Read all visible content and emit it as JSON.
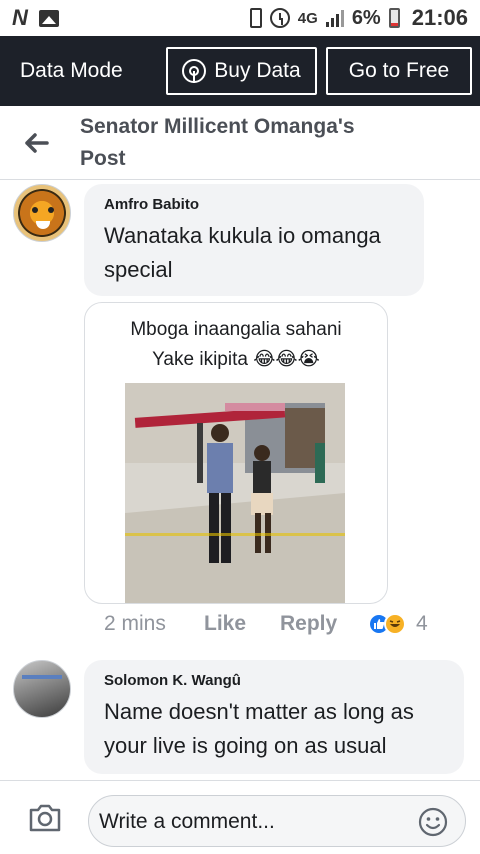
{
  "status_bar": {
    "network": "4G",
    "battery_percent": "6%",
    "time": "21:06",
    "icons": [
      "n-icon",
      "image-icon",
      "phone-icon",
      "alarm-icon",
      "signal-icon",
      "battery-icon"
    ]
  },
  "data_mode": {
    "label": "Data Mode",
    "buy_label": "Buy Data",
    "free_label": "Go to Free"
  },
  "header": {
    "title": "Senator Millicent Omanga's Post"
  },
  "comments": [
    {
      "author": "Amfro Babito",
      "text": "Wanataka kukula io omanga special",
      "meme_caption_line1": "Mboga inaangalia sahani",
      "meme_caption_line2": "Yake ikipita 😂😂😭",
      "time": "2 mins",
      "like_label": "Like",
      "reply_label": "Reply",
      "reaction_count": "4"
    },
    {
      "author": "Solomon K. Wangû",
      "text": "Name doesn't matter as long as your live is going on as usual"
    }
  ],
  "composer": {
    "placeholder": "Write a comment..."
  },
  "colors": {
    "data_bar_bg": "#1d2129",
    "bubble_bg": "#f2f3f5",
    "meta_text": "#90949c",
    "like_blue": "#1877f2"
  }
}
